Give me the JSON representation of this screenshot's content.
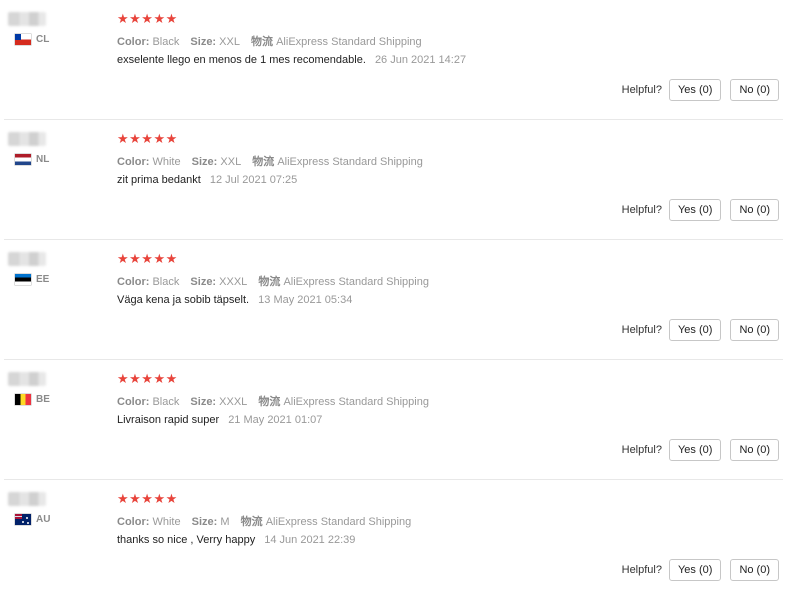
{
  "reviews": [
    {
      "country": "CL",
      "flag": "flag-cl",
      "stars": "★★★★★",
      "rating": 5,
      "color_label": "Color:",
      "color": "Black",
      "size_label": "Size:",
      "size": "XXL",
      "shipping_label": "物流",
      "shipping": "AliExpress Standard Shipping",
      "text": "exselente llego en menos de 1 mes recomendable.",
      "date": "26 Jun 2021 14:27",
      "helpful_label": "Helpful?",
      "yes": "Yes (0)",
      "no": "No (0)"
    },
    {
      "country": "NL",
      "flag": "flag-nl",
      "stars": "★★★★★",
      "rating": 5,
      "color_label": "Color:",
      "color": "White",
      "size_label": "Size:",
      "size": "XXL",
      "shipping_label": "物流",
      "shipping": "AliExpress Standard Shipping",
      "text": "zit prima bedankt",
      "date": "12 Jul 2021 07:25",
      "helpful_label": "Helpful?",
      "yes": "Yes (0)",
      "no": "No (0)"
    },
    {
      "country": "EE",
      "flag": "flag-ee",
      "stars": "★★★★★",
      "rating": 5,
      "color_label": "Color:",
      "color": "Black",
      "size_label": "Size:",
      "size": "XXXL",
      "shipping_label": "物流",
      "shipping": "AliExpress Standard Shipping",
      "text": "Väga kena ja sobib täpselt.",
      "date": "13 May 2021 05:34",
      "helpful_label": "Helpful?",
      "yes": "Yes (0)",
      "no": "No (0)"
    },
    {
      "country": "BE",
      "flag": "flag-be",
      "stars": "★★★★★",
      "rating": 5,
      "color_label": "Color:",
      "color": "Black",
      "size_label": "Size:",
      "size": "XXXL",
      "shipping_label": "物流",
      "shipping": "AliExpress Standard Shipping",
      "text": "Livraison rapid super",
      "date": "21 May 2021 01:07",
      "helpful_label": "Helpful?",
      "yes": "Yes (0)",
      "no": "No (0)"
    },
    {
      "country": "AU",
      "flag": "flag-au",
      "stars": "★★★★★",
      "rating": 5,
      "color_label": "Color:",
      "color": "White",
      "size_label": "Size:",
      "size": "M",
      "shipping_label": "物流",
      "shipping": "AliExpress Standard Shipping",
      "text": "thanks so nice , Verry happy",
      "date": "14 Jun 2021 22:39",
      "helpful_label": "Helpful?",
      "yes": "Yes (0)",
      "no": "No (0)"
    }
  ]
}
